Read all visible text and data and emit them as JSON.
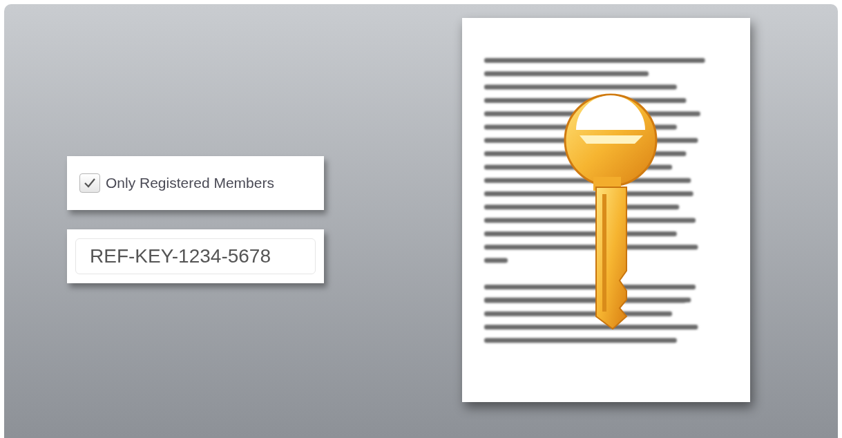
{
  "option": {
    "label": "Only Registered Members",
    "checked": true
  },
  "key_field": {
    "value": "REF-KEY-1234-5678"
  }
}
